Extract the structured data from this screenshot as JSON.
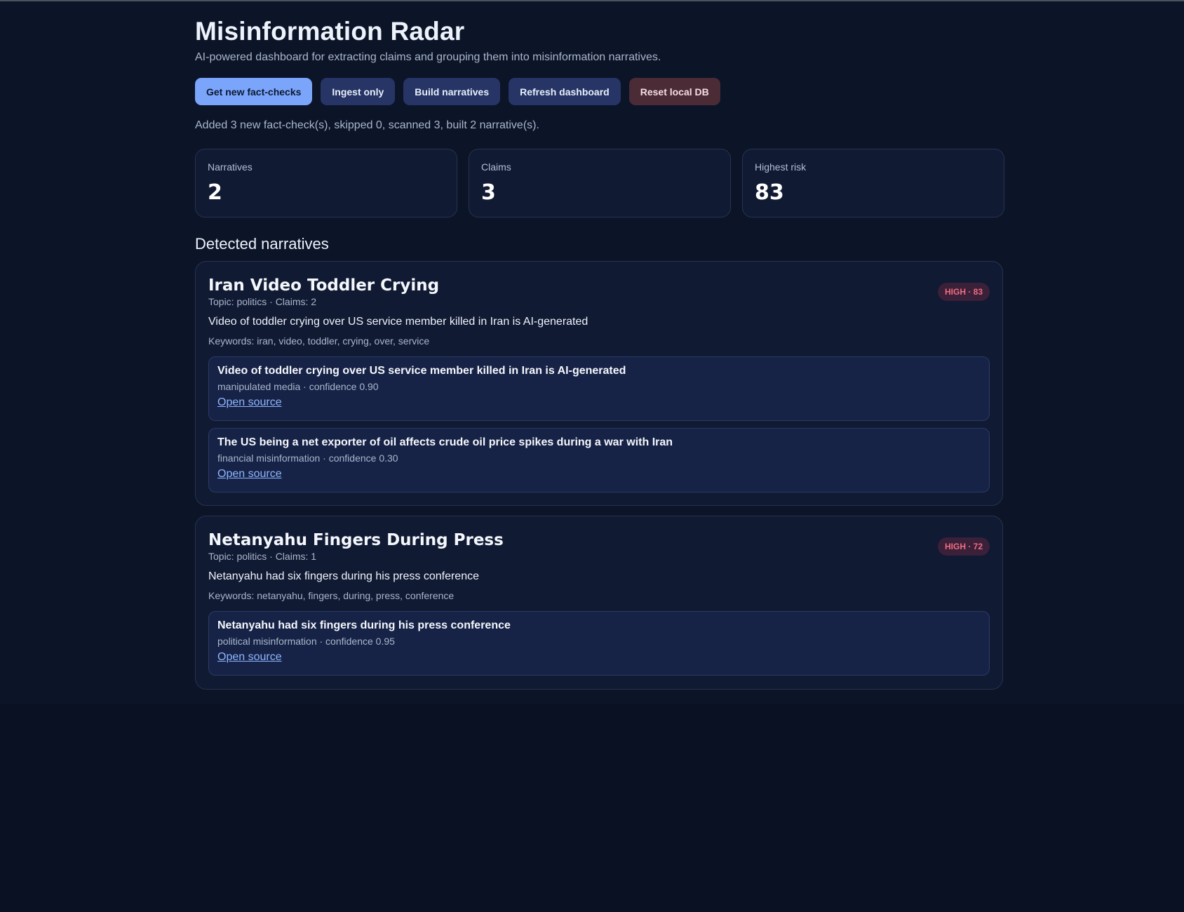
{
  "header": {
    "title": "Misinformation Radar",
    "subtitle": "AI-powered dashboard for extracting claims and grouping them into misinformation narratives."
  },
  "actions": {
    "get_new_label": "Get new fact-checks",
    "ingest_label": "Ingest only",
    "build_label": "Build narratives",
    "refresh_label": "Refresh dashboard",
    "reset_label": "Reset local DB"
  },
  "status_message": "Added 3 new fact-check(s), skipped 0, scanned 3, built 2 narrative(s).",
  "stats": {
    "narratives": {
      "label": "Narratives",
      "value": "2"
    },
    "claims": {
      "label": "Claims",
      "value": "3"
    },
    "highest_risk": {
      "label": "Highest risk",
      "value": "83"
    }
  },
  "section_title": "Detected narratives",
  "narratives": [
    {
      "title": "Iran Video Toddler Crying",
      "meta": "Topic: politics · Claims: 2",
      "summary": "Video of toddler crying over US service member killed in Iran is AI-generated",
      "keywords": "Keywords: iran, video, toddler, crying, over, service",
      "badge": "HIGH · 83",
      "claims": [
        {
          "title": "Video of toddler crying over US service member killed in Iran is AI-generated",
          "meta": "manipulated media · confidence 0.90",
          "link": "Open source"
        },
        {
          "title": "The US being a net exporter of oil affects crude oil price spikes during a war with Iran",
          "meta": "financial misinformation · confidence 0.30",
          "link": "Open source"
        }
      ]
    },
    {
      "title": "Netanyahu Fingers During Press",
      "meta": "Topic: politics · Claims: 1",
      "summary": "Netanyahu had six fingers during his press conference",
      "keywords": "Keywords: netanyahu, fingers, during, press, conference",
      "badge": "HIGH · 72",
      "claims": [
        {
          "title": "Netanyahu had six fingers during his press conference",
          "meta": "political misinformation · confidence 0.95",
          "link": "Open source"
        }
      ]
    }
  ],
  "colors": {
    "background": "#0c1428",
    "card": "#111a33",
    "primary_button": "#7aa5fb",
    "danger_button": "#4a2b36",
    "risk_badge_text": "#f06d82",
    "link": "#8db5ff"
  }
}
